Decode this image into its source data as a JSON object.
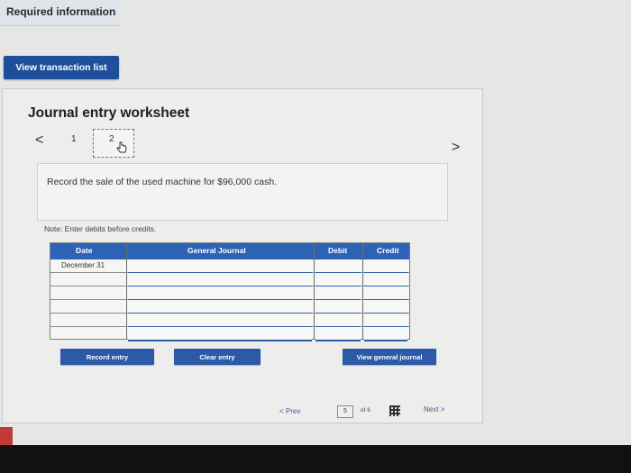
{
  "header": {
    "required_info": "Required information"
  },
  "actions": {
    "view_transaction_list": "View transaction list"
  },
  "worksheet": {
    "title": "Journal entry worksheet",
    "nav": {
      "prev": "<",
      "next": ">"
    },
    "pages": [
      "1",
      "2"
    ],
    "current_page": "2",
    "instruction": "Record the sale of the used machine for $96,000 cash.",
    "note": "Note: Enter debits before credits.",
    "table": {
      "columns": [
        "Date",
        "General Journal",
        "Debit",
        "Credit"
      ],
      "rows": [
        {
          "date": "December 31",
          "account": "",
          "debit": "",
          "credit": ""
        },
        {
          "date": "",
          "account": "",
          "debit": "",
          "credit": ""
        },
        {
          "date": "",
          "account": "",
          "debit": "",
          "credit": ""
        },
        {
          "date": "",
          "account": "",
          "debit": "",
          "credit": ""
        },
        {
          "date": "",
          "account": "",
          "debit": "",
          "credit": ""
        },
        {
          "date": "",
          "account": "",
          "debit": "",
          "credit": ""
        }
      ]
    },
    "buttons": {
      "record_entry": "Record entry",
      "clear_entry": "Clear entry",
      "view_general_journal": "View general journal"
    }
  },
  "footer": {
    "prev": "< Prev",
    "page": "5",
    "of": "of 6",
    "next": "Next >"
  },
  "colors": {
    "primary": "#1f4f9a",
    "table_header": "#2d63b4",
    "input_underline": "#2f5ea8"
  }
}
